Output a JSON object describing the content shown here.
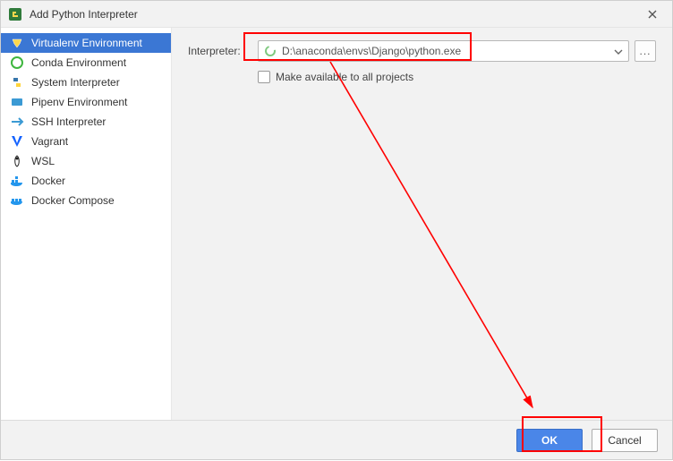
{
  "window": {
    "title": "Add Python Interpreter"
  },
  "sidebar": {
    "items": [
      {
        "id": "virtualenv",
        "label": "Virtualenv Environment"
      },
      {
        "id": "conda",
        "label": "Conda Environment"
      },
      {
        "id": "system",
        "label": "System Interpreter"
      },
      {
        "id": "pipenv",
        "label": "Pipenv Environment"
      },
      {
        "id": "ssh",
        "label": "SSH Interpreter"
      },
      {
        "id": "vagrant",
        "label": "Vagrant"
      },
      {
        "id": "wsl",
        "label": "WSL"
      },
      {
        "id": "docker",
        "label": "Docker"
      },
      {
        "id": "compose",
        "label": "Docker Compose"
      }
    ],
    "selectedIndex": 0
  },
  "form": {
    "interpreter_label": "Interpreter:",
    "interpreter_value": "D:\\anaconda\\envs\\Django\\python.exe",
    "browse_label": "...",
    "make_available_label": "Make available to all projects",
    "make_available_checked": false
  },
  "footer": {
    "ok_label": "OK",
    "cancel_label": "Cancel"
  }
}
